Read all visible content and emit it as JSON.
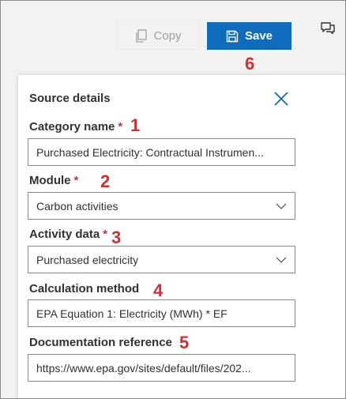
{
  "toolbar": {
    "copy_label": "Copy",
    "save_label": "Save"
  },
  "annotations": [
    "1",
    "2",
    "3",
    "4",
    "5",
    "6"
  ],
  "panel": {
    "title": "Source details",
    "required_marker": "*",
    "fields": [
      {
        "label": "Category name",
        "value": "Purchased Electricity: Contractual Instrumen...",
        "required": true
      },
      {
        "label": "Module",
        "value": "Carbon activities",
        "required": true
      },
      {
        "label": "Activity data",
        "value": "Purchased electricity",
        "required": true
      },
      {
        "label": "Calculation method",
        "value": "EPA Equation 1: Electricity (MWh) * EF",
        "required": false
      },
      {
        "label": "Documentation reference",
        "value": "https://www.epa.gov/sites/default/files/202...",
        "required": false
      }
    ]
  },
  "icons": {
    "chat": "chat-icon",
    "copy": "copy-icon",
    "save": "save-icon",
    "close": "close-icon",
    "dropdown": "chevron-down-icon"
  },
  "colors": {
    "accent": "#0f6cbd",
    "annotation": "#d32f2f",
    "required": "#c4314b"
  }
}
